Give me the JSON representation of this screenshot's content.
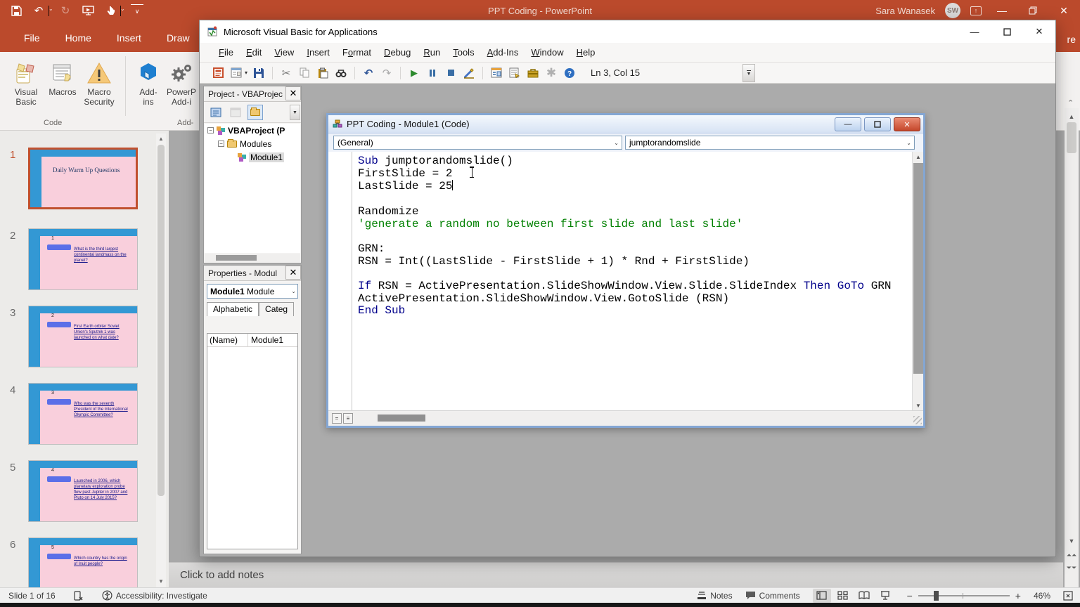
{
  "powerpoint": {
    "titlebar": {
      "title": "PPT Coding  -  PowerPoint",
      "user": "Sara Wanasek",
      "initials": "SW"
    },
    "tabs": [
      "File",
      "Home",
      "Insert",
      "Draw"
    ],
    "share_remnant": "re",
    "ribbon": {
      "code_group_label": "Code",
      "addins_group_label": "Add-",
      "buttons": [
        {
          "line1": "Visual",
          "line2": "Basic"
        },
        {
          "line1": "Macros",
          "line2": ""
        },
        {
          "line1": "Macro",
          "line2": "Security"
        },
        {
          "line1": "Add-",
          "line2": "ins"
        },
        {
          "line1": "PowerP",
          "line2": "Add-i"
        }
      ]
    },
    "slides": [
      {
        "num": "1",
        "selected": true,
        "kind": "title",
        "title": "Daily Warm Up Questions"
      },
      {
        "num": "2",
        "selected": false,
        "kind": "question",
        "q_num": "1",
        "q_text": "What is the third largest continental landmass on the planet?"
      },
      {
        "num": "3",
        "selected": false,
        "kind": "question",
        "q_num": "2",
        "q_text": "First Earth orbiter Soviet Union's Sputnik 1 was launched on what date?"
      },
      {
        "num": "4",
        "selected": false,
        "kind": "question",
        "q_num": "3",
        "q_text": "Who was the seventh President of the International Olympic Committee?"
      },
      {
        "num": "5",
        "selected": false,
        "kind": "question",
        "q_num": "4",
        "q_text": "Launched in 2006, which planetary exploration probe flew past Jupiter in 2007 and Pluto on 14 July 2015?"
      },
      {
        "num": "6",
        "selected": false,
        "kind": "question",
        "q_num": "5",
        "q_text": "Which country has the origin of Inuit people?"
      }
    ],
    "notes_placeholder": "Click to add notes",
    "statusbar": {
      "slide_counter": "Slide 1 of 16",
      "accessibility": "Accessibility: Investigate",
      "notes_label": "Notes",
      "comments_label": "Comments",
      "zoom_level": "46%"
    }
  },
  "vba": {
    "window_title": "Microsoft Visual Basic for Applications",
    "menus": [
      {
        "label": "File",
        "u": 0
      },
      {
        "label": "Edit",
        "u": 0
      },
      {
        "label": "View",
        "u": 0
      },
      {
        "label": "Insert",
        "u": 0
      },
      {
        "label": "Format",
        "u": 1
      },
      {
        "label": "Debug",
        "u": 0
      },
      {
        "label": "Run",
        "u": 0
      },
      {
        "label": "Tools",
        "u": 0
      },
      {
        "label": "Add-Ins",
        "u": 0
      },
      {
        "label": "Window",
        "u": 0
      },
      {
        "label": "Help",
        "u": 0
      }
    ],
    "toolbar": {
      "position_indicator": "Ln 3, Col 15"
    },
    "project_panel": {
      "title": "Project - VBAProjec",
      "tree": [
        {
          "label": "VBAProject (P",
          "level": 0,
          "icon": "project",
          "bold": true,
          "selected": false,
          "expander": true
        },
        {
          "label": "Modules",
          "level": 1,
          "icon": "folder",
          "bold": false,
          "selected": false,
          "expander": true
        },
        {
          "label": "Module1",
          "level": 2,
          "icon": "module",
          "bold": false,
          "selected": true,
          "expander": false
        }
      ]
    },
    "properties_panel": {
      "title": "Properties - Modul",
      "selector_bold": "Module1",
      "selector_rest": " Module",
      "tab_active": "Alphabetic",
      "tab_inactive": "Categ",
      "rows": [
        {
          "name": "(Name)",
          "value": "Module1"
        }
      ]
    },
    "code_window": {
      "title": "PPT Coding - Module1 (Code)",
      "left_combo": "(General)",
      "right_combo": "jumptorandomslide",
      "lines": [
        [
          {
            "t": "Sub",
            "c": "kw"
          },
          {
            "t": " jumptorandomslide()",
            "c": "pl"
          }
        ],
        [
          {
            "t": "FirstSlide = 2",
            "c": "pl"
          }
        ],
        [
          {
            "t": "LastSlide = 25",
            "c": "pl"
          },
          {
            "t": "",
            "c": "caret"
          }
        ],
        [],
        [
          {
            "t": "Randomize",
            "c": "pl"
          }
        ],
        [
          {
            "t": "'generate a random no between first slide and last slide'",
            "c": "cm"
          }
        ],
        [],
        [
          {
            "t": "GRN:",
            "c": "pl"
          }
        ],
        [
          {
            "t": "RSN = Int((LastSlide - FirstSlide + 1) * Rnd + FirstSlide)",
            "c": "pl"
          }
        ],
        [],
        [
          {
            "t": "If",
            "c": "kw"
          },
          {
            "t": " RSN = ActivePresentation.SlideShowWindow.View.Slide.SlideIndex ",
            "c": "pl"
          },
          {
            "t": "Then",
            "c": "kw"
          },
          {
            "t": " ",
            "c": "pl"
          },
          {
            "t": "GoTo",
            "c": "kw"
          },
          {
            "t": " GRN",
            "c": "pl"
          }
        ],
        [
          {
            "t": "ActivePresentation.SlideShowWindow.View.GotoSlide (RSN)",
            "c": "pl"
          }
        ],
        [
          {
            "t": "End Sub",
            "c": "kw"
          }
        ]
      ]
    }
  },
  "colors": {
    "accent": "#BB4A2C",
    "selection_border": "#C0502E",
    "keyword_blue": "#00008B",
    "comment_green": "#008000",
    "slide_pink": "#F9CFDC",
    "slide_blue": "#3398D4"
  }
}
